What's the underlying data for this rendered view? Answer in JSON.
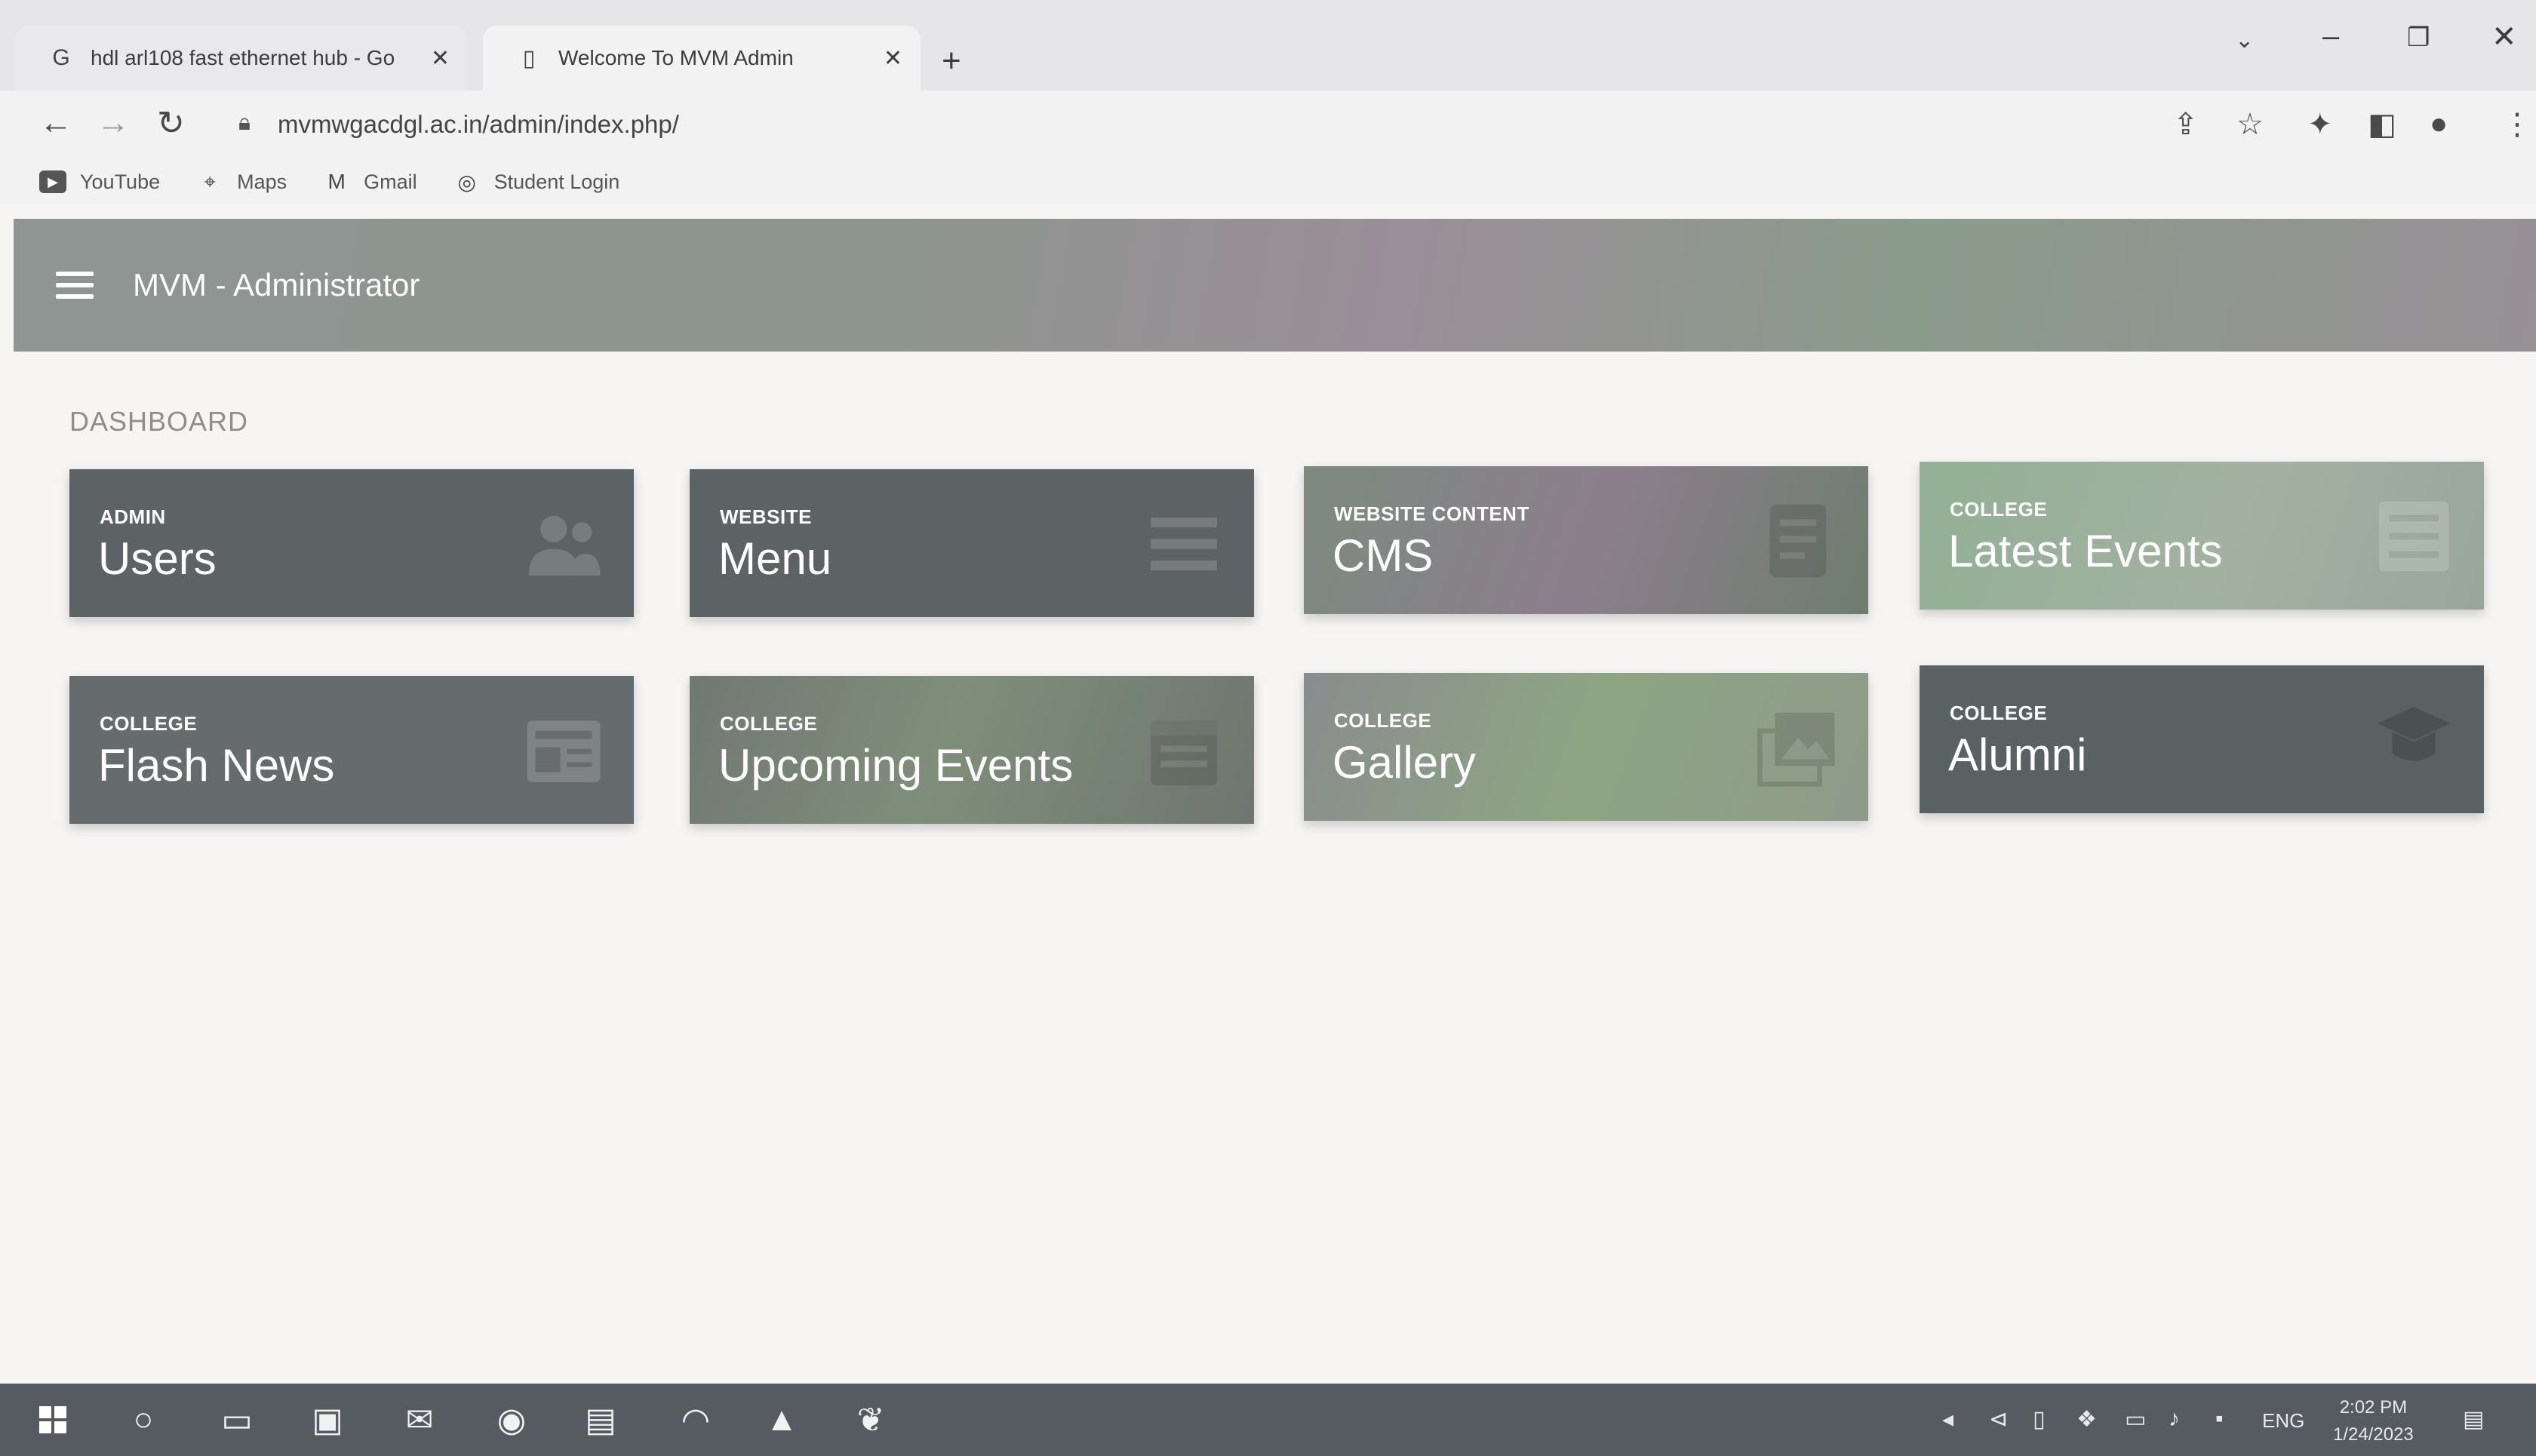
{
  "browser": {
    "tabs": [
      {
        "title": "hdl arl108 fast ethernet hub - Go",
        "favicon": "google-icon"
      },
      {
        "title": "Welcome To MVM Admin",
        "favicon": "page-icon"
      }
    ],
    "url": "mvmwgacdgl.ac.in/admin/index.php/",
    "bookmarks": [
      {
        "label": "YouTube",
        "icon": "youtube-icon"
      },
      {
        "label": "Maps",
        "icon": "maps-pin-icon"
      },
      {
        "label": "Gmail",
        "icon": "gmail-icon"
      },
      {
        "label": "Student Login",
        "icon": "globe-icon"
      }
    ]
  },
  "app": {
    "title": "MVM - Administrator"
  },
  "dashboard": {
    "label": "DASHBOARD",
    "cards": [
      {
        "category": "ADMIN",
        "title": "Users",
        "icon": "users-icon"
      },
      {
        "category": "WEBSITE",
        "title": "Menu",
        "icon": "menu-list-icon"
      },
      {
        "category": "WEBSITE CONTENT",
        "title": "CMS",
        "icon": "document-icon"
      },
      {
        "category": "COLLEGE",
        "title": "Latest Events",
        "icon": "list-icon"
      },
      {
        "category": "COLLEGE",
        "title": "Flash News",
        "icon": "newspaper-icon"
      },
      {
        "category": "COLLEGE",
        "title": "Upcoming Events",
        "icon": "calendar-icon"
      },
      {
        "category": "COLLEGE",
        "title": "Gallery",
        "icon": "image-icon"
      },
      {
        "category": "COLLEGE",
        "title": "Alumni",
        "icon": "graduate-icon"
      }
    ]
  },
  "taskbar": {
    "language": "ENG",
    "time": "2:02 PM",
    "date": "1/24/2023"
  }
}
